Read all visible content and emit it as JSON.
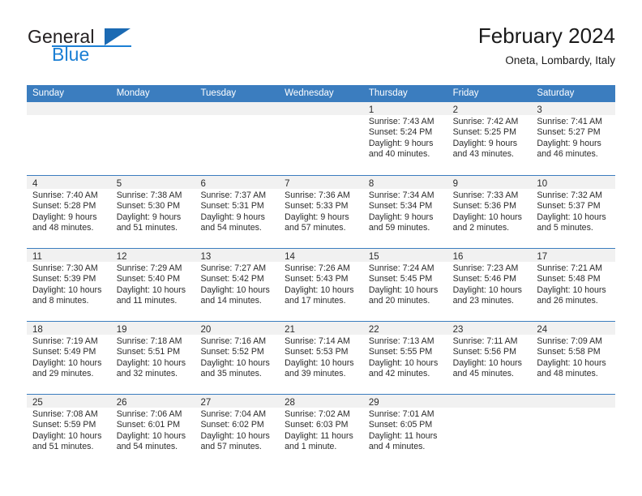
{
  "brand": {
    "name_top": "General",
    "name_bottom": "Blue",
    "accent_color": "#1b7fd4",
    "triangle_color": "#1b6ab3"
  },
  "header": {
    "title": "February 2024",
    "subtitle": "Oneta, Lombardy, Italy"
  },
  "theme": {
    "header_row_color": "#3b7dbf",
    "day_band_color": "#f1f1f1",
    "text_color": "#2b2b2b"
  },
  "weekdays": [
    "Sunday",
    "Monday",
    "Tuesday",
    "Wednesday",
    "Thursday",
    "Friday",
    "Saturday"
  ],
  "weeks": [
    [
      {
        "day": "",
        "lines": []
      },
      {
        "day": "",
        "lines": []
      },
      {
        "day": "",
        "lines": []
      },
      {
        "day": "",
        "lines": []
      },
      {
        "day": "1",
        "lines": [
          "Sunrise: 7:43 AM",
          "Sunset: 5:24 PM",
          "Daylight: 9 hours",
          "and 40 minutes."
        ]
      },
      {
        "day": "2",
        "lines": [
          "Sunrise: 7:42 AM",
          "Sunset: 5:25 PM",
          "Daylight: 9 hours",
          "and 43 minutes."
        ]
      },
      {
        "day": "3",
        "lines": [
          "Sunrise: 7:41 AM",
          "Sunset: 5:27 PM",
          "Daylight: 9 hours",
          "and 46 minutes."
        ]
      }
    ],
    [
      {
        "day": "4",
        "lines": [
          "Sunrise: 7:40 AM",
          "Sunset: 5:28 PM",
          "Daylight: 9 hours",
          "and 48 minutes."
        ]
      },
      {
        "day": "5",
        "lines": [
          "Sunrise: 7:38 AM",
          "Sunset: 5:30 PM",
          "Daylight: 9 hours",
          "and 51 minutes."
        ]
      },
      {
        "day": "6",
        "lines": [
          "Sunrise: 7:37 AM",
          "Sunset: 5:31 PM",
          "Daylight: 9 hours",
          "and 54 minutes."
        ]
      },
      {
        "day": "7",
        "lines": [
          "Sunrise: 7:36 AM",
          "Sunset: 5:33 PM",
          "Daylight: 9 hours",
          "and 57 minutes."
        ]
      },
      {
        "day": "8",
        "lines": [
          "Sunrise: 7:34 AM",
          "Sunset: 5:34 PM",
          "Daylight: 9 hours",
          "and 59 minutes."
        ]
      },
      {
        "day": "9",
        "lines": [
          "Sunrise: 7:33 AM",
          "Sunset: 5:36 PM",
          "Daylight: 10 hours",
          "and 2 minutes."
        ]
      },
      {
        "day": "10",
        "lines": [
          "Sunrise: 7:32 AM",
          "Sunset: 5:37 PM",
          "Daylight: 10 hours",
          "and 5 minutes."
        ]
      }
    ],
    [
      {
        "day": "11",
        "lines": [
          "Sunrise: 7:30 AM",
          "Sunset: 5:39 PM",
          "Daylight: 10 hours",
          "and 8 minutes."
        ]
      },
      {
        "day": "12",
        "lines": [
          "Sunrise: 7:29 AM",
          "Sunset: 5:40 PM",
          "Daylight: 10 hours",
          "and 11 minutes."
        ]
      },
      {
        "day": "13",
        "lines": [
          "Sunrise: 7:27 AM",
          "Sunset: 5:42 PM",
          "Daylight: 10 hours",
          "and 14 minutes."
        ]
      },
      {
        "day": "14",
        "lines": [
          "Sunrise: 7:26 AM",
          "Sunset: 5:43 PM",
          "Daylight: 10 hours",
          "and 17 minutes."
        ]
      },
      {
        "day": "15",
        "lines": [
          "Sunrise: 7:24 AM",
          "Sunset: 5:45 PM",
          "Daylight: 10 hours",
          "and 20 minutes."
        ]
      },
      {
        "day": "16",
        "lines": [
          "Sunrise: 7:23 AM",
          "Sunset: 5:46 PM",
          "Daylight: 10 hours",
          "and 23 minutes."
        ]
      },
      {
        "day": "17",
        "lines": [
          "Sunrise: 7:21 AM",
          "Sunset: 5:48 PM",
          "Daylight: 10 hours",
          "and 26 minutes."
        ]
      }
    ],
    [
      {
        "day": "18",
        "lines": [
          "Sunrise: 7:19 AM",
          "Sunset: 5:49 PM",
          "Daylight: 10 hours",
          "and 29 minutes."
        ]
      },
      {
        "day": "19",
        "lines": [
          "Sunrise: 7:18 AM",
          "Sunset: 5:51 PM",
          "Daylight: 10 hours",
          "and 32 minutes."
        ]
      },
      {
        "day": "20",
        "lines": [
          "Sunrise: 7:16 AM",
          "Sunset: 5:52 PM",
          "Daylight: 10 hours",
          "and 35 minutes."
        ]
      },
      {
        "day": "21",
        "lines": [
          "Sunrise: 7:14 AM",
          "Sunset: 5:53 PM",
          "Daylight: 10 hours",
          "and 39 minutes."
        ]
      },
      {
        "day": "22",
        "lines": [
          "Sunrise: 7:13 AM",
          "Sunset: 5:55 PM",
          "Daylight: 10 hours",
          "and 42 minutes."
        ]
      },
      {
        "day": "23",
        "lines": [
          "Sunrise: 7:11 AM",
          "Sunset: 5:56 PM",
          "Daylight: 10 hours",
          "and 45 minutes."
        ]
      },
      {
        "day": "24",
        "lines": [
          "Sunrise: 7:09 AM",
          "Sunset: 5:58 PM",
          "Daylight: 10 hours",
          "and 48 minutes."
        ]
      }
    ],
    [
      {
        "day": "25",
        "lines": [
          "Sunrise: 7:08 AM",
          "Sunset: 5:59 PM",
          "Daylight: 10 hours",
          "and 51 minutes."
        ]
      },
      {
        "day": "26",
        "lines": [
          "Sunrise: 7:06 AM",
          "Sunset: 6:01 PM",
          "Daylight: 10 hours",
          "and 54 minutes."
        ]
      },
      {
        "day": "27",
        "lines": [
          "Sunrise: 7:04 AM",
          "Sunset: 6:02 PM",
          "Daylight: 10 hours",
          "and 57 minutes."
        ]
      },
      {
        "day": "28",
        "lines": [
          "Sunrise: 7:02 AM",
          "Sunset: 6:03 PM",
          "Daylight: 11 hours",
          "and 1 minute."
        ]
      },
      {
        "day": "29",
        "lines": [
          "Sunrise: 7:01 AM",
          "Sunset: 6:05 PM",
          "Daylight: 11 hours",
          "and 4 minutes."
        ]
      },
      {
        "day": "",
        "lines": []
      },
      {
        "day": "",
        "lines": []
      }
    ]
  ]
}
